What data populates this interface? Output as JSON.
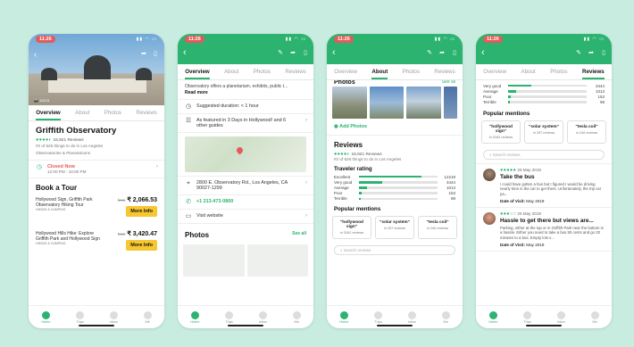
{
  "colors": {
    "brand": "#2bb36f",
    "alert": "#e45a5a",
    "cta": "#f6c730",
    "background": "#c9ece0"
  },
  "status": {
    "time": "11:26"
  },
  "tabs": [
    "Overview",
    "About",
    "Photos",
    "Reviews"
  ],
  "nav": [
    "Home",
    "Trips",
    "Inbox",
    "Me"
  ],
  "screen1": {
    "photo_count": "10123",
    "title": "Griffith Observatory",
    "reviews": "16,921 Reviews",
    "rank": "#2 of 626 things to do in Los Angeles",
    "category": "Observatories & Planetariums",
    "closed": "Closed Now",
    "hours": "12:00 PM - 10:00 PM",
    "tour_section": "Book a Tour",
    "tours": [
      {
        "name": "Hollywood Sign, Griffith Park Observatory Hiking Tour",
        "meta": "HIKING & CAMPING",
        "was": "from",
        "price": "₹ 2,066.53",
        "cta": "More Info"
      },
      {
        "name": "Hollywood Hills Hike: Explore Griffith Park and Hollywood Sign",
        "meta": "HIKING & CAMPING",
        "was": "from",
        "price": "₹ 3,420.47",
        "cta": "More Info"
      }
    ]
  },
  "screen2": {
    "desc": "Observatory offers a planetarium, exhibits, public t...",
    "read_more": "Read more",
    "duration": "Suggested duration: < 1 hour",
    "featured": "As featured in 3 Days in Hollywood! and 6 other guides",
    "address": "2800 E. Observatory Rd., Los Angeles, CA 90027-1299",
    "phone": "+1 213-473-0800",
    "website": "Visit website",
    "photos_title": "Photos",
    "see_all": "See all"
  },
  "screen3": {
    "photos_heading": "Photos",
    "see_all": "See all",
    "add_photos": "Add Photos",
    "reviews_title": "Reviews",
    "reviews_count": "16,921 Reviews",
    "rank": "#2 of 626 things to do in Los Angeles",
    "traveler_rating": "Traveler rating",
    "ratings": [
      {
        "label": "Excellent",
        "count": "12218",
        "fraction": 0.8
      },
      {
        "label": "Very good",
        "count": "3444",
        "fraction": 0.3
      },
      {
        "label": "Average",
        "count": "1013",
        "fraction": 0.1
      },
      {
        "label": "Poor",
        "count": "153",
        "fraction": 0.03
      },
      {
        "label": "Terrible",
        "count": "98",
        "fraction": 0.02
      }
    ],
    "popular_mentions": "Popular mentions",
    "mentions": [
      {
        "text": "\"hollywood sign\"",
        "count": "in 3162 reviews"
      },
      {
        "text": "\"solar system\"",
        "count": "in 257 reviews"
      },
      {
        "text": "\"tesla coil\"",
        "count": "in 240 reviews"
      }
    ],
    "search_placeholder": "Search reviews"
  },
  "screen4": {
    "ratings": [
      {
        "label": "Very good",
        "count": "3444",
        "fraction": 0.3
      },
      {
        "label": "Average",
        "count": "1013",
        "fraction": 0.1
      },
      {
        "label": "Poor",
        "count": "153",
        "fraction": 0.03
      },
      {
        "label": "Terrible",
        "count": "98",
        "fraction": 0.02
      }
    ],
    "popular_mentions": "Popular mentions",
    "mentions": [
      {
        "text": "\"hollywood sign\"",
        "count": "in 3162 reviews"
      },
      {
        "text": "\"solar system\"",
        "count": "in 257 reviews"
      },
      {
        "text": "\"tesla coil\"",
        "count": "in 240 reviews"
      }
    ],
    "search_placeholder": "Search reviews",
    "reviews": [
      {
        "date": "26 May 2019",
        "title": "Take the bus",
        "text": "I could have gotten a bus but I figured I would be driving nearly time in the car to get there. Unfortunately, the trip car pa...",
        "visit_label": "Date of Visit:",
        "visit": "May 2019"
      },
      {
        "date": "25 May 2019",
        "title": "Hassle to get there but views are...",
        "text": "Parking, either at the top or in Griffith Park near the bottom is a hassle. Either you need to take a bus 50 cents and go 20 minutes to a bus. Empty lots s...",
        "visit_label": "Date of Visit:",
        "visit": "May 2019"
      }
    ]
  }
}
